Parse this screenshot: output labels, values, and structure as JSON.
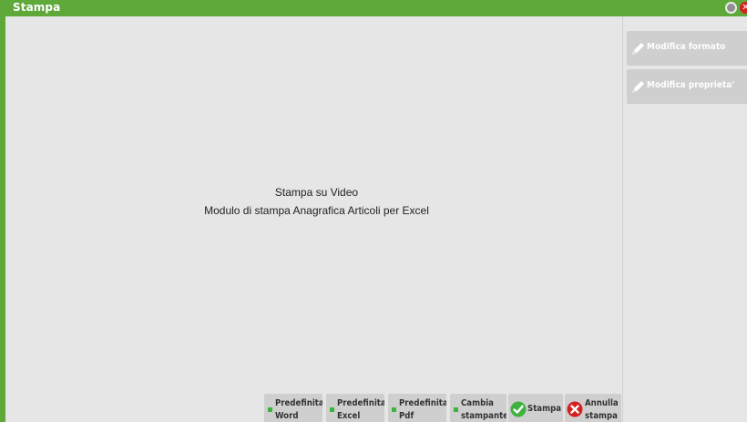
{
  "window": {
    "title": "Stampa"
  },
  "main": {
    "line1": "Stampa su Video",
    "line2": "Modulo di stampa Anagrafica Articoli per Excel"
  },
  "side_buttons": [
    {
      "label": "Modifica formato",
      "icon": "pencil-icon"
    },
    {
      "label": "Modifica proprieta'",
      "icon": "pencil-icon"
    }
  ],
  "bottom_buttons": [
    {
      "line1": "Predefinita",
      "line2": "Word"
    },
    {
      "line1": "Predefinita",
      "line2": "Excel"
    },
    {
      "line1": "Predefinita",
      "line2": "Pdf"
    },
    {
      "line1": "Cambia",
      "line2": "stampante"
    },
    {
      "line1": "Stampa",
      "icon": "check-icon"
    },
    {
      "line1": "Annulla",
      "line2": "stampa",
      "icon": "cancel-icon"
    }
  ],
  "colors": {
    "accent": "#5fa83a",
    "background": "#e6e6e6",
    "button": "#cfcfcf",
    "indicator": "#3fb13f",
    "close": "#d42020"
  }
}
